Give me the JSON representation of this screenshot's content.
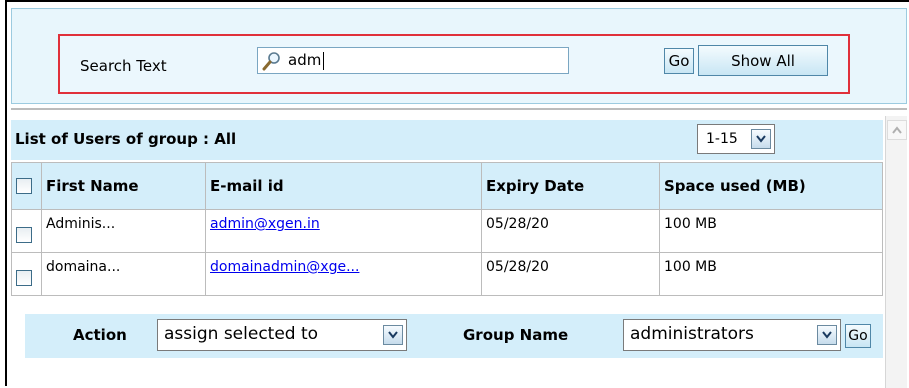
{
  "search": {
    "label": "Search Text",
    "value": "adm",
    "go_label": "Go",
    "show_all_label": "Show All"
  },
  "list": {
    "title": "List of Users of group : All",
    "range": "1-15",
    "columns": [
      "First Name",
      "E-mail id",
      "Expiry Date",
      "Space used (MB)"
    ],
    "rows": [
      {
        "first_name": "Adminis...",
        "email": "admin@xgen.in",
        "expiry": "05/28/20",
        "space": "100 MB"
      },
      {
        "first_name": "domaina...",
        "email": "domainadmin@xge...",
        "expiry": "05/28/20",
        "space": "100 MB"
      }
    ]
  },
  "actions": {
    "action_label": "Action",
    "action_value": "assign selected to",
    "group_label": "Group Name",
    "group_value": "administrators",
    "go_label": "Go"
  },
  "colors": {
    "panel_bg": "#e8f6fc",
    "header_bg": "#d4eefa",
    "highlight_border": "#e0303a",
    "link": "#0000ee"
  }
}
